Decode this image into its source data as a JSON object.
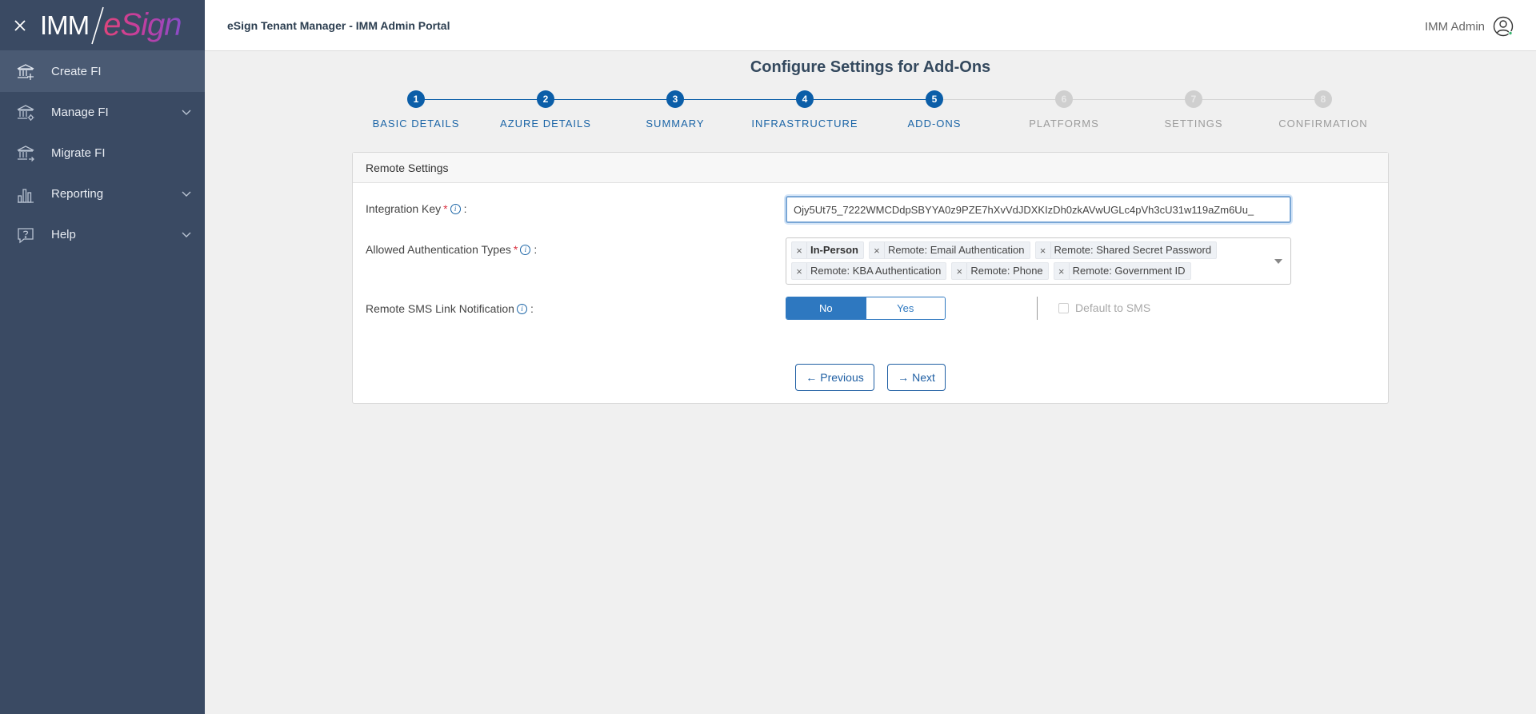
{
  "app": {
    "title": "eSign Tenant Manager - IMM Admin Portal",
    "logo_imm": "IMM",
    "logo_esign": "eSign",
    "user_name": "IMM Admin"
  },
  "sidebar": {
    "items": [
      {
        "label": "Create FI",
        "icon": "bank-plus-icon",
        "active": true,
        "has_chevron": false
      },
      {
        "label": "Manage FI",
        "icon": "bank-gear-icon",
        "active": false,
        "has_chevron": true
      },
      {
        "label": "Migrate FI",
        "icon": "bank-arrow-icon",
        "active": false,
        "has_chevron": false
      },
      {
        "label": "Reporting",
        "icon": "bar-chart-icon",
        "active": false,
        "has_chevron": true
      },
      {
        "label": "Help",
        "icon": "help-icon",
        "active": false,
        "has_chevron": true
      }
    ]
  },
  "page": {
    "title": "Configure Settings for Add-Ons"
  },
  "stepper": {
    "steps": [
      {
        "number": "1",
        "label": "BASIC DETAILS",
        "state": "done"
      },
      {
        "number": "2",
        "label": "AZURE DETAILS",
        "state": "done"
      },
      {
        "number": "3",
        "label": "SUMMARY",
        "state": "done"
      },
      {
        "number": "4",
        "label": "INFRASTRUCTURE",
        "state": "done"
      },
      {
        "number": "5",
        "label": "ADD-ONS",
        "state": "current"
      },
      {
        "number": "6",
        "label": "PLATFORMS",
        "state": "todo"
      },
      {
        "number": "7",
        "label": "SETTINGS",
        "state": "todo"
      },
      {
        "number": "8",
        "label": "CONFIRMATION",
        "state": "todo"
      }
    ]
  },
  "panel": {
    "title": "Remote Settings",
    "integration_key": {
      "label": "Integration Key",
      "required_mark": "*",
      "colon": ":",
      "value": "Ojy5Ut75_7222WMCDdpSBYYA0z9PZE7hXvVdJDXKIzDh0zkAVwUGLc4pVh3cU31w119aZm6Uu_"
    },
    "auth_types": {
      "label": "Allowed Authentication Types",
      "required_mark": "*",
      "colon": ":",
      "tags": [
        {
          "text": "In-Person",
          "bold": true
        },
        {
          "text": "Remote: Email Authentication",
          "bold": false
        },
        {
          "text": "Remote: Shared Secret Password",
          "bold": false
        },
        {
          "text": "Remote: KBA Authentication",
          "bold": false
        },
        {
          "text": "Remote: Phone",
          "bold": false
        },
        {
          "text": "Remote: Government ID",
          "bold": false
        }
      ],
      "remove_glyph": "×"
    },
    "sms": {
      "label": "Remote SMS Link Notification",
      "colon": ":",
      "option_no": "No",
      "option_yes": "Yes",
      "selected": "No",
      "default_to_sms_label": "Default to SMS",
      "default_to_sms_checked": false
    },
    "buttons": {
      "previous": "Previous",
      "next": "Next",
      "previous_arrow": "←",
      "next_arrow": "→"
    }
  },
  "colors": {
    "sidebar_bg": "#3a4a63",
    "primary": "#0b5ea8",
    "step_todo": "#cfcfcf",
    "required": "#d9303f"
  }
}
